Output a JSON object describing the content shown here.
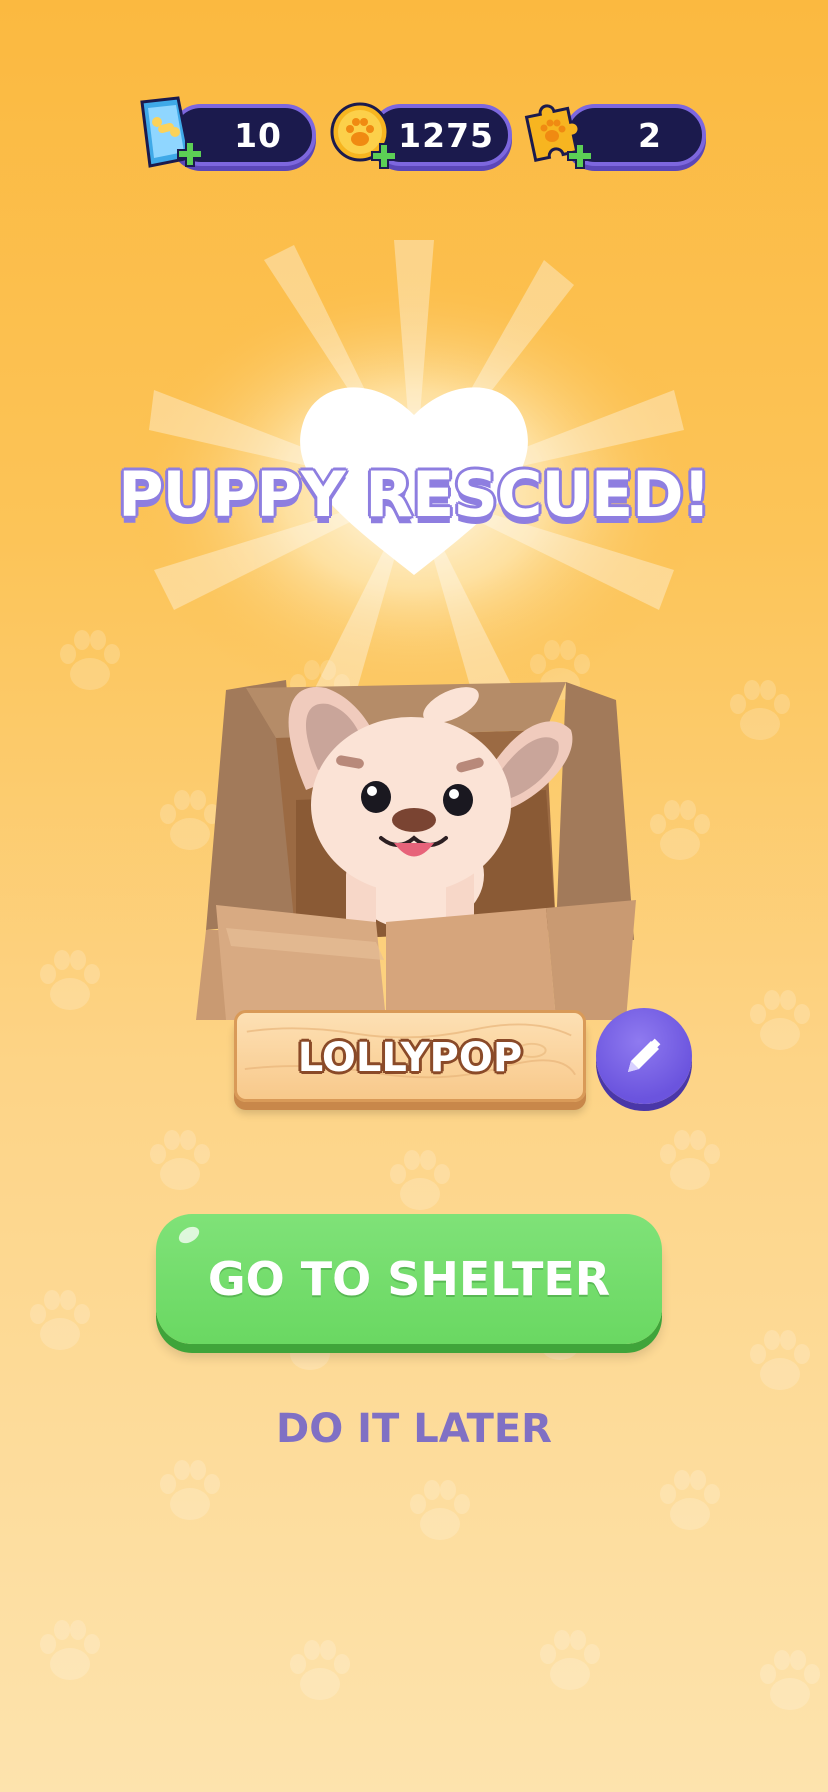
{
  "currencies": [
    {
      "icon": "dog-food-bag-icon",
      "value": "10"
    },
    {
      "icon": "paw-coin-icon",
      "value": "1275"
    },
    {
      "icon": "puzzle-piece-icon",
      "value": "2"
    }
  ],
  "heading": "PUPPY RESCUED!",
  "puppy": {
    "name": "LOLLYPOP"
  },
  "buttons": {
    "primary_label": "GO TO SHELTER",
    "secondary_label": "DO IT LATER",
    "edit_icon": "pencil-icon"
  },
  "colors": {
    "background_top": "#fbb940",
    "background_bottom": "#fde3ad",
    "accent_purple": "#7d67de",
    "button_green": "#6ad862"
  }
}
